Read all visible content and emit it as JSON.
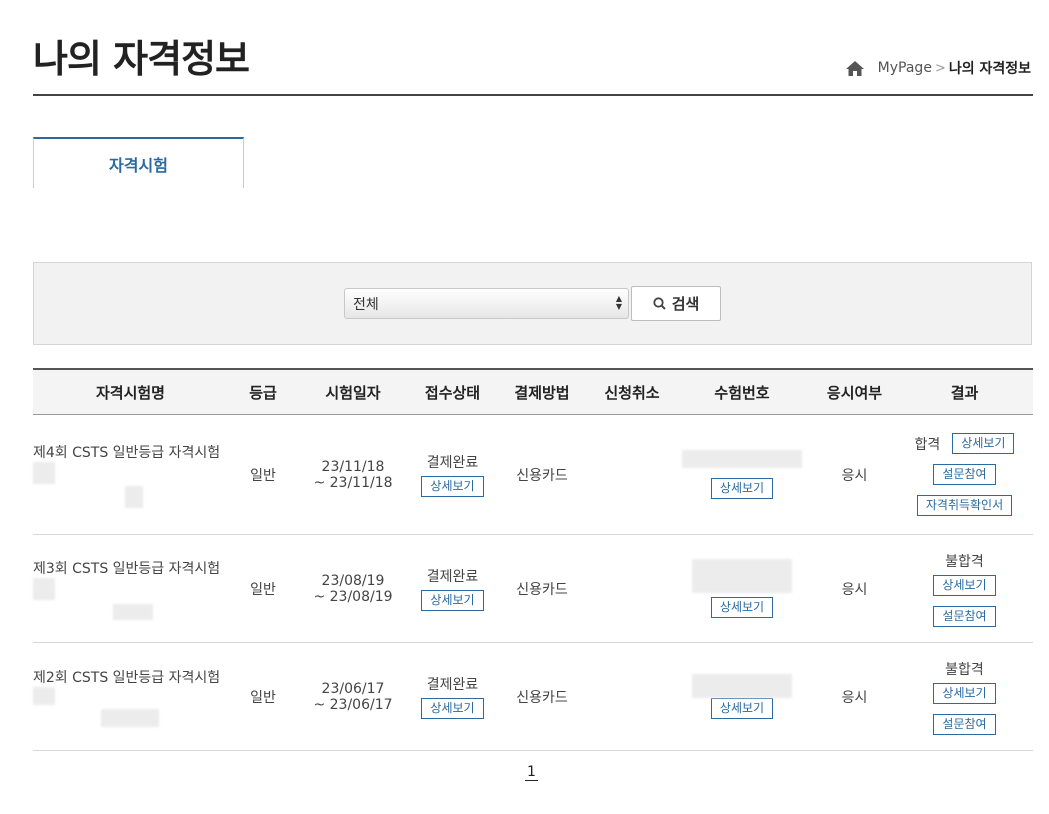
{
  "page": {
    "title": "나의 자격정보"
  },
  "breadcrumb": {
    "home_icon": "home-icon",
    "parent": "MyPage",
    "separator": ">",
    "current": "나의 자격정보"
  },
  "tabs": [
    {
      "label": "자격시험",
      "active": true
    }
  ],
  "search": {
    "select_value": "전체",
    "button_label": "검색",
    "button_icon": "search-icon"
  },
  "table": {
    "headers": [
      "자격시험명",
      "등급",
      "시험일자",
      "접수상태",
      "결제방법",
      "신청취소",
      "수험번호",
      "응시여부",
      "결과"
    ],
    "rows": [
      {
        "name": "제4회 CSTS 일반등급 자격시험",
        "grade": "일반",
        "date_from": "23/11/18",
        "date_to": "~ 23/11/18",
        "status": "결제완료",
        "status_btn": "상세보기",
        "payment": "신용카드",
        "cancel": "",
        "exam_btn": "상세보기",
        "attend": "응시",
        "result": "합격",
        "result_btn": "상세보기",
        "survey_btn": "설문참여",
        "cert_btn": "자격취득확인서"
      },
      {
        "name": "제3회 CSTS 일반등급 자격시험",
        "grade": "일반",
        "date_from": "23/08/19",
        "date_to": "~ 23/08/19",
        "status": "결제완료",
        "status_btn": "상세보기",
        "payment": "신용카드",
        "cancel": "",
        "exam_btn": "상세보기",
        "attend": "응시",
        "result": "불합격",
        "result_btn": "상세보기",
        "survey_btn": "설문참여"
      },
      {
        "name": "제2회 CSTS 일반등급 자격시험",
        "grade": "일반",
        "date_from": "23/06/17",
        "date_to": "~ 23/06/17",
        "status": "결제완료",
        "status_btn": "상세보기",
        "payment": "신용카드",
        "cancel": "",
        "exam_btn": "상세보기",
        "attend": "응시",
        "result": "불합격",
        "result_btn": "상세보기",
        "survey_btn": "설문참여"
      }
    ]
  },
  "pagination": {
    "current": "1"
  },
  "colors": {
    "accent": "#2a6aa0",
    "header_bg": "#f4f4f4",
    "search_bg": "#f2f2f2"
  }
}
